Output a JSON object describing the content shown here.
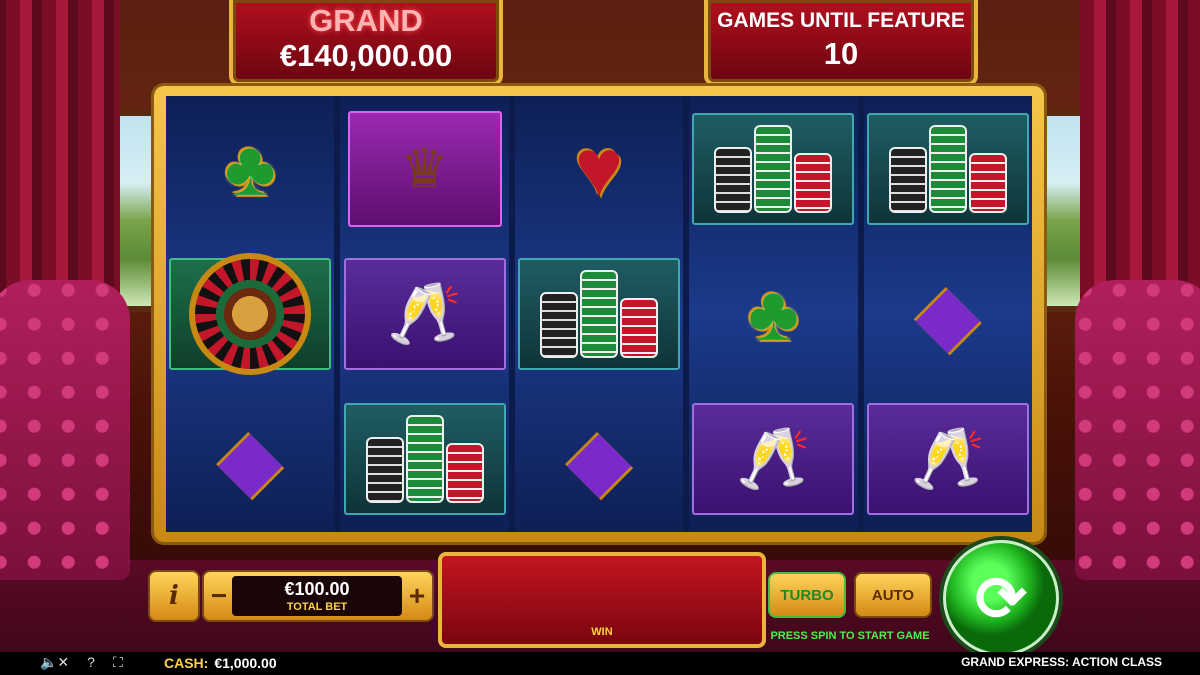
{
  "jackpot": {
    "label": "GRAND",
    "amount": "€140,000.00"
  },
  "feature": {
    "label": "GAMES UNTIL FEATURE",
    "count": "10"
  },
  "reels": [
    [
      "club",
      "roulette",
      "diamond"
    ],
    [
      "lady",
      "champagne",
      "chips"
    ],
    [
      "heart",
      "chips",
      "diamond"
    ],
    [
      "chips",
      "club",
      "champagne"
    ],
    [
      "chips",
      "diamond",
      "champagne"
    ]
  ],
  "controls": {
    "info_icon": "i",
    "minus": "−",
    "plus": "+",
    "bet_value": "€100.00",
    "bet_label": "TOTAL BET",
    "win_label": "WIN",
    "turbo_label": "TURBO",
    "auto_label": "AUTO",
    "prompt": "PRESS SPIN TO START GAME",
    "spin_icon": "refresh-icon"
  },
  "status": {
    "cash_label": "CASH:",
    "cash_value": "€1,000.00",
    "game_title": "GRAND EXPRESS: ACTION CLASS"
  }
}
